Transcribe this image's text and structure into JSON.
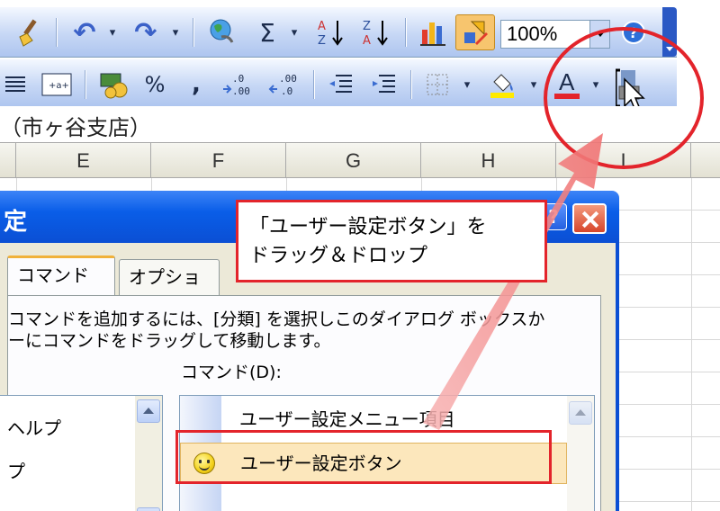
{
  "toolbar1": {
    "zoom_value": "100%",
    "sigma_label": "Σ",
    "icons": [
      "brush-icon",
      "undo-icon",
      "redo-icon",
      "hyperlink-globe-icon",
      "autosum-icon",
      "sort-ascending-icon",
      "sort-descending-icon",
      "chart-wizard-icon",
      "drawing-icon",
      "help-icon"
    ]
  },
  "toolbar2": {
    "percent_label": "%",
    "comma_label": ",",
    "font_color_label": "A",
    "icons": [
      "align-justify-icon",
      "merge-center-icon",
      "currency-icon",
      "percent-icon",
      "comma-icon",
      "increase-decimal-icon",
      "decrease-decimal-icon",
      "decrease-indent-icon",
      "increase-indent-icon",
      "borders-icon",
      "fill-color-icon",
      "font-color-icon"
    ]
  },
  "cell_text": "（市ヶ谷支店）",
  "columns": [
    "E",
    "F",
    "G",
    "H",
    "I"
  ],
  "dialog": {
    "title": "定",
    "help_label": "?",
    "tabs": [
      {
        "label": "コマンド",
        "active": true
      },
      {
        "label": "オプション",
        "active": false
      }
    ],
    "instruction_line1": "コマンドを追加するには、[分類] を選択しこのダイアログ ボックスか",
    "instruction_line2": "ーにコマンドをドラッグして移動します。",
    "command_label": "コマンド(D):",
    "categories": [
      "ヘルプ",
      "プ"
    ],
    "commands": [
      {
        "label": "ユーザー設定メニュー項目"
      },
      {
        "label": "ユーザー設定ボタン",
        "icon": "smiley-icon",
        "selected": true
      }
    ]
  },
  "callout": {
    "line1": "「ユーザー設定ボタン」を",
    "line2": "ドラッグ＆ドロップ"
  },
  "colors": {
    "annotation_red": "#e3242b",
    "title_blue": "#0b4fd4",
    "selection_bg": "#fce7bc"
  }
}
